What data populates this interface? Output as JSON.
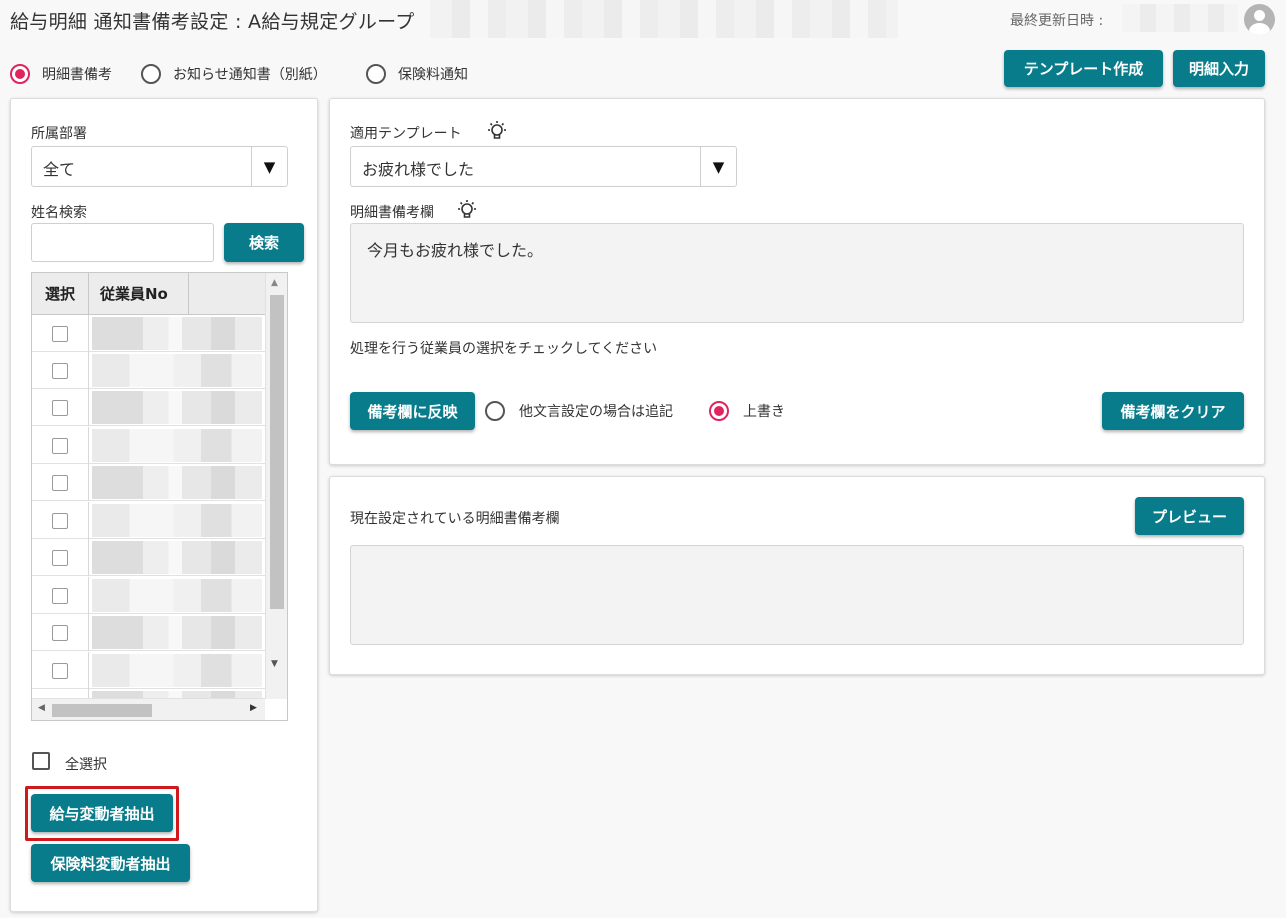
{
  "header": {
    "title": "給与明細 通知書備考設定 : A給与規定グループ",
    "updated_label": "最終更新日時 :"
  },
  "notice_type_options": [
    {
      "label": "明細書備考",
      "selected": true
    },
    {
      "label": "お知らせ通知書（別紙）",
      "selected": false
    },
    {
      "label": "保険料通知",
      "selected": false
    }
  ],
  "toolbar": {
    "template_create": "テンプレート作成",
    "detail_input": "明細入力"
  },
  "left_panel": {
    "department_label": "所属部署",
    "department_value": "全て",
    "name_search_label": "姓名検索",
    "name_search_value": "",
    "search_button": "検索",
    "grid_columns": [
      "選択",
      "従業員No"
    ],
    "grid_row_count": 11,
    "select_all_label": "全選択",
    "salary_change_button": "給与変動者抽出",
    "insurance_change_button": "保険料変動者抽出"
  },
  "template_panel": {
    "template_label": "適用テンプレート",
    "template_value": "お疲れ様でした",
    "remarks_label": "明細書備考欄",
    "remarks_text": "今月もお疲れ様でした。",
    "instruction": "処理を行う従業員の選択をチェックしてください",
    "apply_button": "備考欄に反映",
    "mode_options": [
      {
        "label": "他文言設定の場合は追記",
        "selected": false
      },
      {
        "label": "上書き",
        "selected": true
      }
    ],
    "clear_button": "備考欄をクリア"
  },
  "current_panel": {
    "label": "現在設定されている明細書備考欄",
    "preview_button": "プレビュー",
    "current_text": ""
  },
  "colors": {
    "primary": "#087c8b",
    "radio_accent": "#e0245e",
    "highlight": "#d0191c"
  }
}
